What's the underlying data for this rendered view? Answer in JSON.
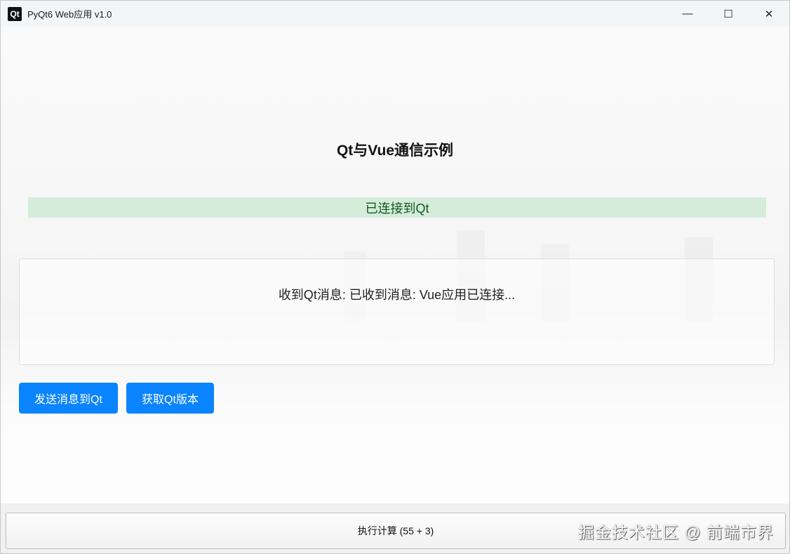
{
  "window": {
    "title": "PyQt6 Web应用 v1.0",
    "logo": "Qt",
    "minimize": "—",
    "maximize": "☐",
    "close": "✕"
  },
  "page": {
    "heading": "Qt与Vue通信示例",
    "status": "已连接到Qt",
    "message": "收到Qt消息: 已收到消息: Vue应用已连接...",
    "send_button": "发送消息到Qt",
    "version_button": "获取Qt版本"
  },
  "footer": {
    "calc_button": "执行计算 (55 + 3)",
    "watermark": "掘金技术社区 @ 前端市界"
  },
  "colors": {
    "accent": "#0a84ff",
    "status_bg": "#d4ecd9",
    "status_fg": "#155724"
  }
}
